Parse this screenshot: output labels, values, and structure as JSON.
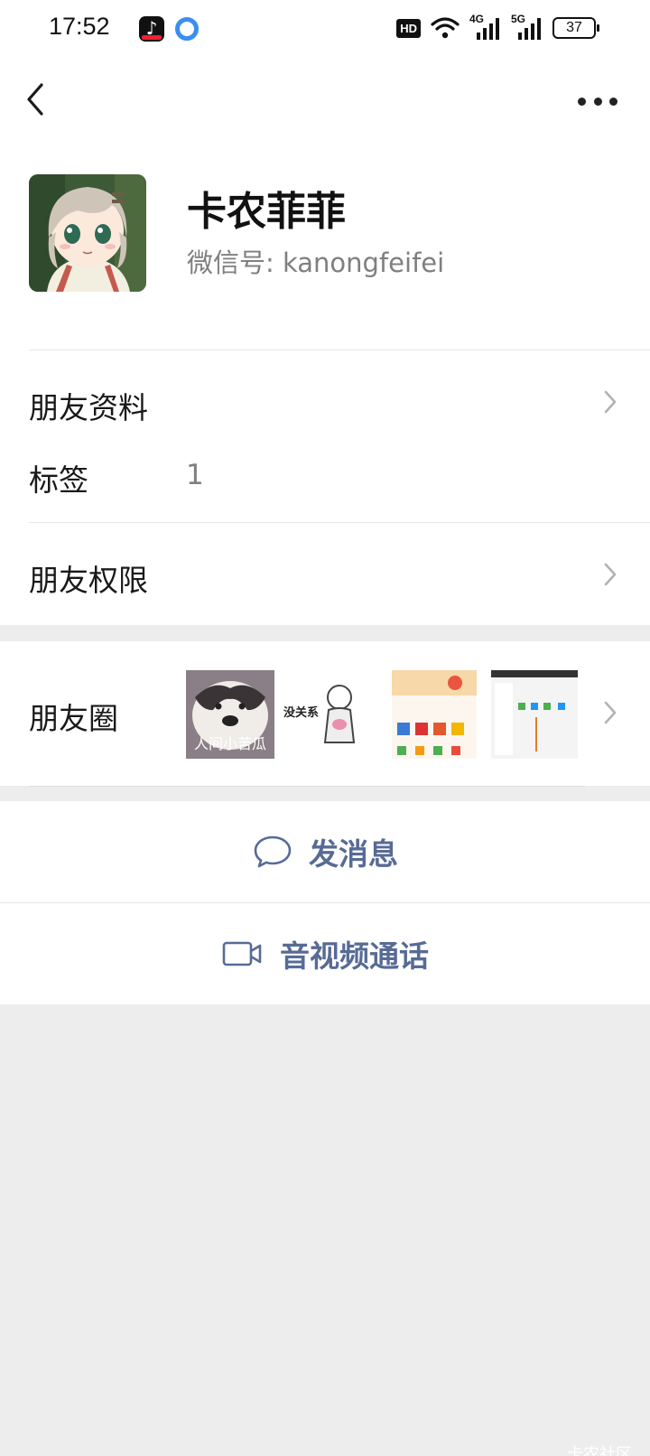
{
  "status_bar": {
    "time": "17:52",
    "hd_label": "HD",
    "network_1": "4G",
    "network_2": "5G",
    "battery_level": "37",
    "icons": [
      "tiktok-app-icon",
      "browser-app-icon",
      "hd-icon",
      "wifi-icon",
      "signal-icon",
      "battery-icon"
    ]
  },
  "nav": {
    "back_icon": "chevron-left-icon",
    "more_icon": "more-dots-icon"
  },
  "profile": {
    "name": "卡农菲菲",
    "wechat_id_label": "微信号:",
    "wechat_id": "kanongfeifei"
  },
  "rows": {
    "friend_info": "朋友资料",
    "tags_label": "标签",
    "tags_value": "1",
    "friend_permissions": "朋友权限",
    "moments": "朋友圈"
  },
  "moments_thumbs": [
    {
      "caption": "人间小苦瓜"
    },
    {
      "caption": "没关系"
    },
    {
      "caption": ""
    },
    {
      "caption": ""
    }
  ],
  "actions": {
    "send_message": "发消息",
    "video_call": "音视频通话"
  },
  "watermark": "卡农社区",
  "colors": {
    "link_blue": "#576b95",
    "background": "#ededed",
    "secondary_text": "#7f7f7f"
  }
}
